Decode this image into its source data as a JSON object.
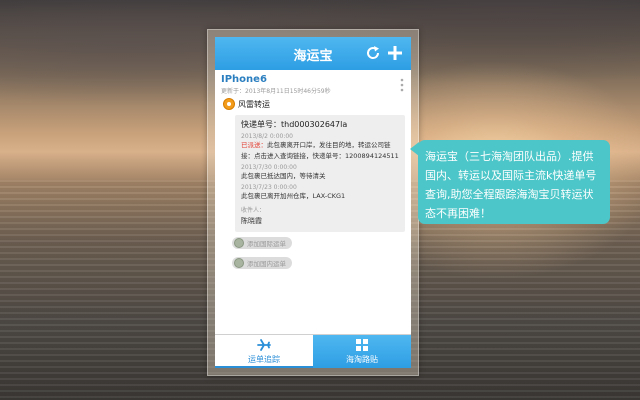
{
  "app": {
    "title": "海运宝"
  },
  "item": {
    "title": "IPhone6",
    "updated": "更新于：2013年8月11日15时46分59秒",
    "carrier_name": "风雷转运",
    "tracking_label": "快递单号：thd000302647la",
    "events": [
      {
        "time": "2013/8/2 0:00:00",
        "status": "已派送：",
        "text": "此包裹离开口岸，发往目的地，转运公司链接：点击进入查询链接，快递单号：1200894124511"
      },
      {
        "time": "2013/7/30 0:00:00",
        "status": "",
        "text": "此包裹已抵达国内，等待清关"
      },
      {
        "time": "2013/7/23 0:00:00",
        "status": "",
        "text": "此包裹已离开加州仓库，LAX-CKG1"
      }
    ],
    "recipient_label": "收件人：",
    "recipient_name": "陈晓霞"
  },
  "actions": {
    "intl_label": "添加国际运单",
    "domestic_label": "添加国内运单"
  },
  "tabs": [
    {
      "label": "运单追踪",
      "icon": "airplane-icon"
    },
    {
      "label": "海淘路贴",
      "icon": "grid-icon"
    }
  ],
  "promo": {
    "text": "海运宝（三七海淘团队出品）.提供国内、转运以及国际主流k快递单号查询,助您全程跟踪海淘宝贝转运状态不再困难！"
  },
  "colors": {
    "header_blue": "#2e9ee4",
    "bubble_teal": "#4cc6c8",
    "status_red": "#e23a2d",
    "carrier_orange": "#f39b1b"
  }
}
